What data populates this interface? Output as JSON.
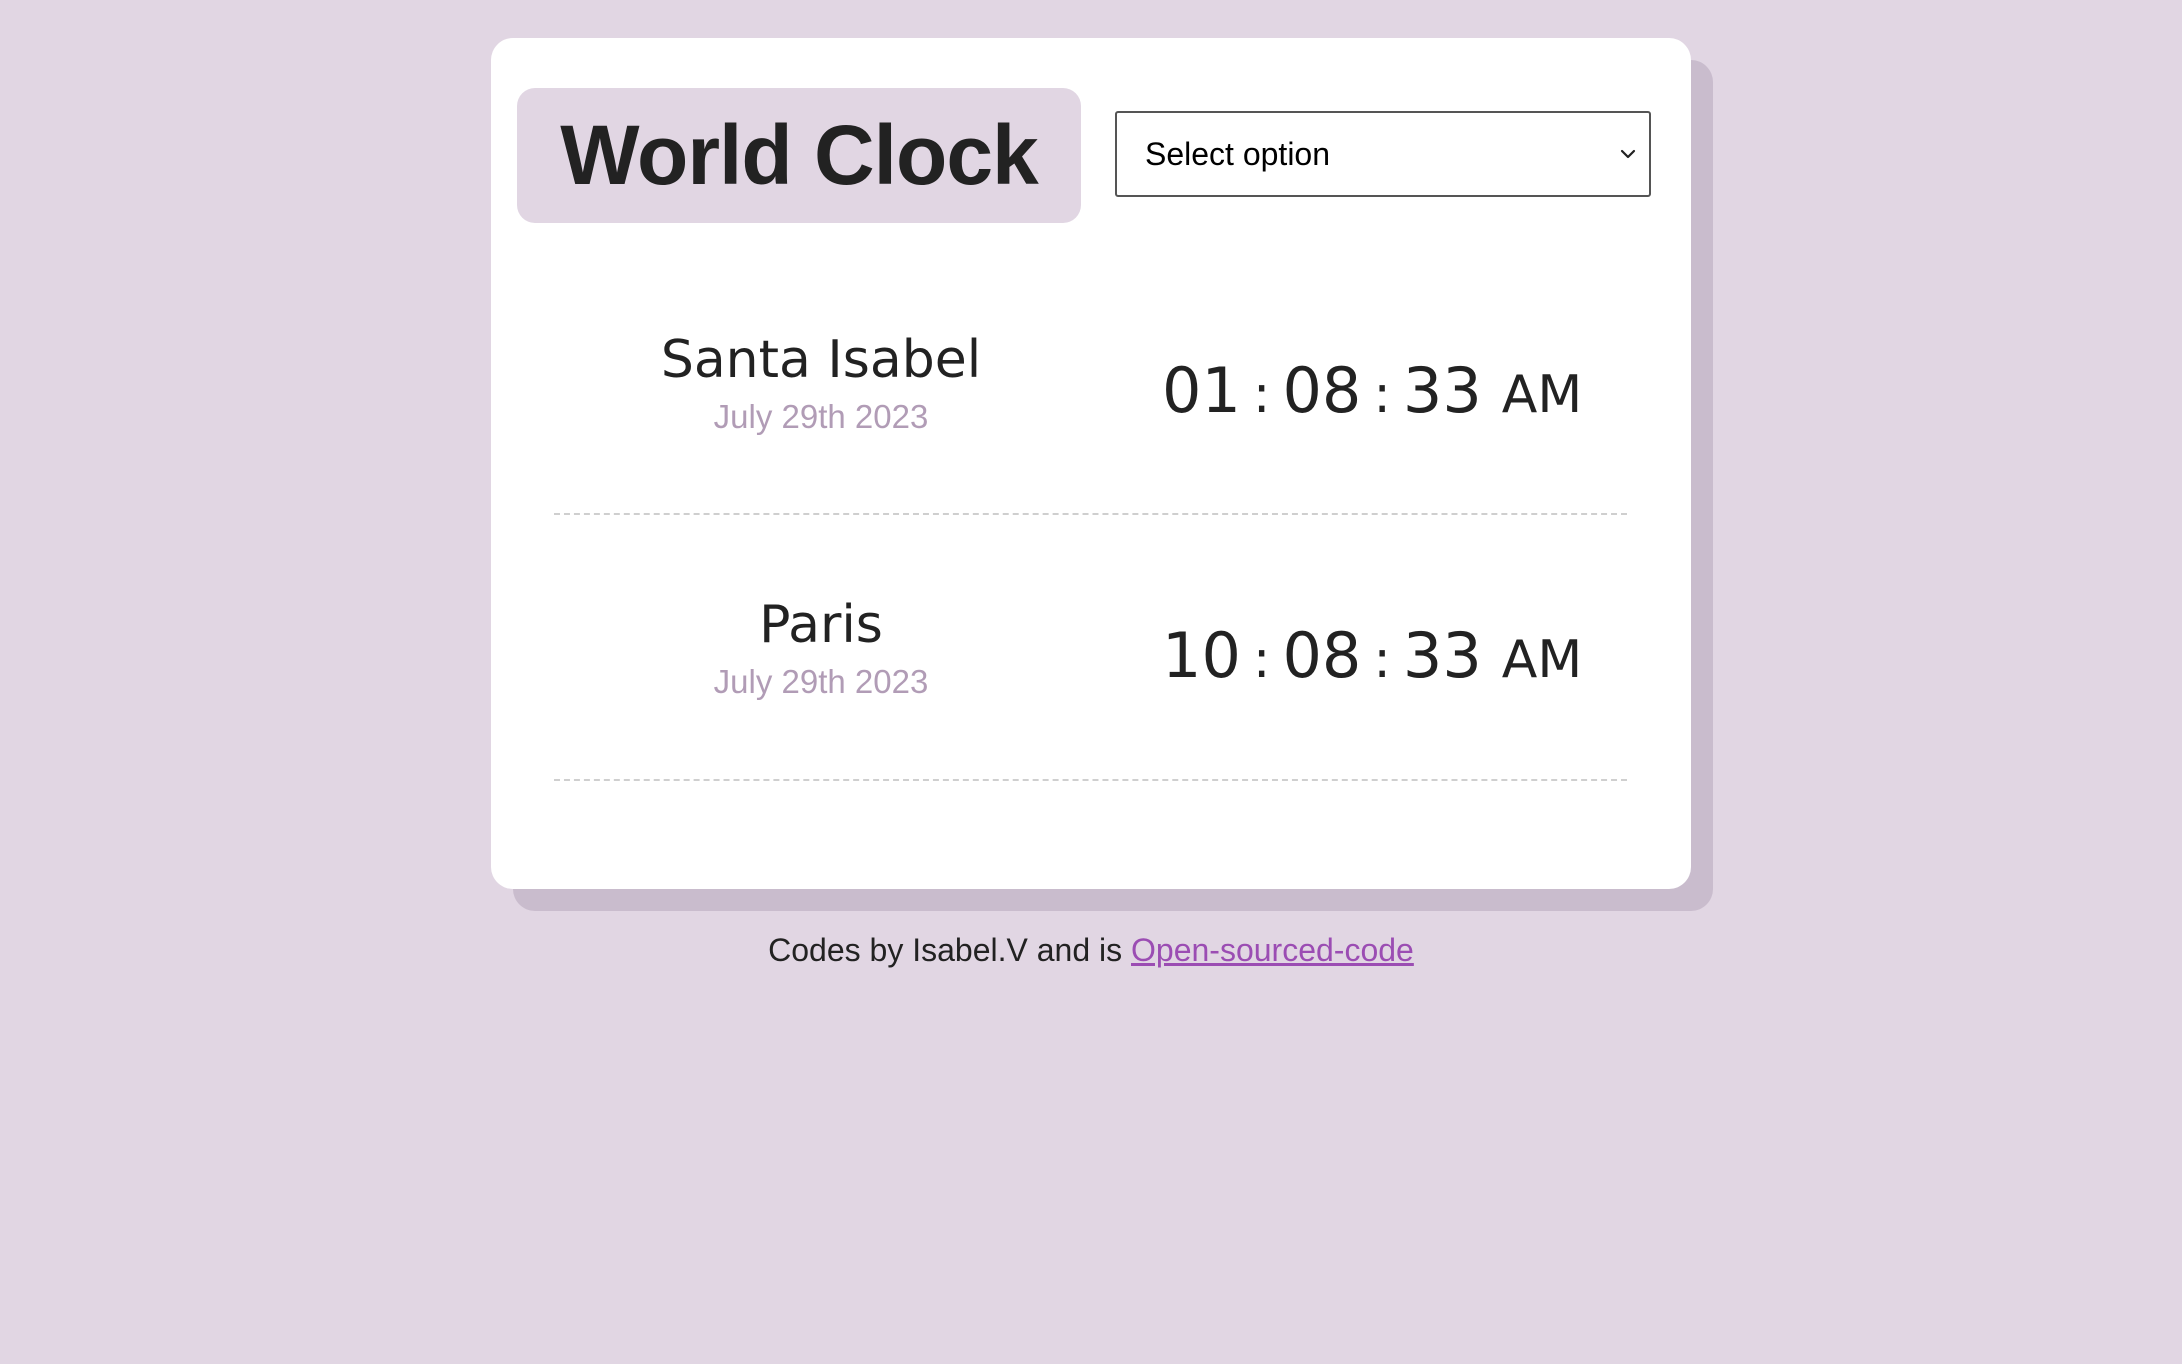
{
  "header": {
    "title": "World Clock"
  },
  "select": {
    "selected_label": "Select option"
  },
  "cities": [
    {
      "name": "Santa Isabel",
      "date": "July 29th 2023",
      "hours": "01",
      "minutes": "08",
      "seconds": "33",
      "ampm": "AM"
    },
    {
      "name": "Paris",
      "date": "July 29th 2023",
      "hours": "10",
      "minutes": "08",
      "seconds": "33",
      "ampm": "AM"
    }
  ],
  "footer": {
    "text": "Codes by Isabel.V and is",
    "link_text": "Open-sourced-code"
  },
  "colors": {
    "background": "#e1d6e3",
    "card": "#ffffff",
    "shadow": "#c9bccd",
    "date_text": "#b19cb6",
    "link": "#9b4db3"
  },
  "icons": {
    "select_arrow": "chevron-down-icon"
  }
}
